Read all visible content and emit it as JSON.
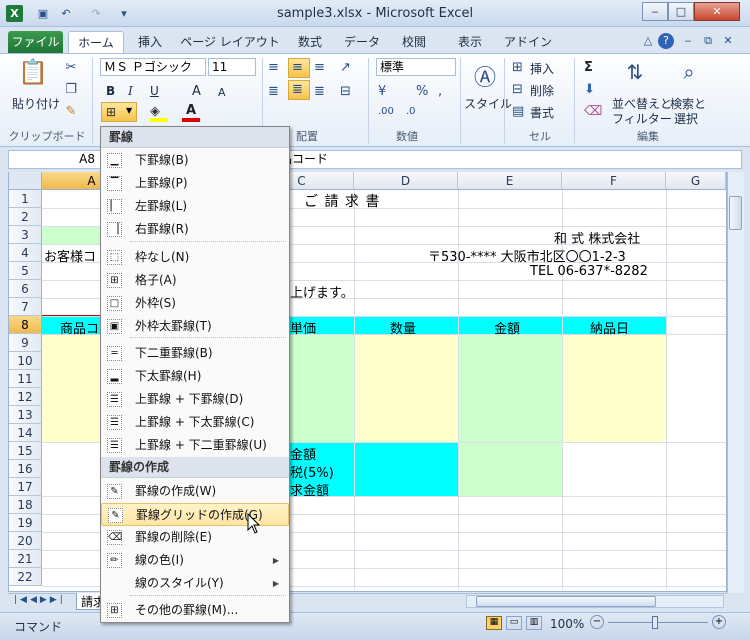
{
  "window": {
    "title": "sample3.xlsx - Microsoft Excel",
    "app_icon": "X"
  },
  "tabs": {
    "file": "ファイル",
    "items": [
      "ホーム",
      "挿入",
      "ページ レイアウト",
      "数式",
      "データ",
      "校閲",
      "表示",
      "アドイン"
    ]
  },
  "ribbon": {
    "paste": "貼り付け",
    "font_name": "ＭＳ Ｐゴシック",
    "font_size": "11",
    "bold": "B",
    "italic": "I",
    "underline": "U",
    "grow": "A",
    "shrink": "A",
    "number_format": "標準",
    "style": "スタイル",
    "insert": "挿入",
    "delete": "削除",
    "format": "書式",
    "sort_filter_1": "並べ替えと",
    "sort_filter_2": "フィルター",
    "find_select_1": "検索と",
    "find_select_2": "選択",
    "groups": {
      "clipboard": "クリップボード",
      "alignment": "配置",
      "number": "数値",
      "cells": "セル",
      "edit": "編集"
    }
  },
  "formula_bar": {
    "name_box": "A8",
    "value": "品コード"
  },
  "columns": [
    "A",
    "C",
    "D",
    "E",
    "F",
    "G"
  ],
  "rows": [
    "1",
    "2",
    "3",
    "4",
    "5",
    "6",
    "7",
    "8",
    "9",
    "10",
    "11",
    "12",
    "13",
    "14",
    "15",
    "16",
    "17",
    "18",
    "19",
    "20",
    "21",
    "22"
  ],
  "cells": {
    "title": "ご 請 求 書",
    "company": "和 式 株式会社",
    "address": "〒530-**** 大阪市北区〇〇1-2-3",
    "tel": "TEL 06-637*-8282",
    "customer": "お客様コ",
    "greeting": "上げます。",
    "h_code": "商品コ",
    "h_price": "単価",
    "h_qty": "数量",
    "h_amount": "金額",
    "h_date": "納品日",
    "subtotal": "金額",
    "tax": "税(5%)",
    "total": "求金額"
  },
  "sheet_tab": "請求",
  "status": {
    "mode": "コマンド",
    "zoom": "100%"
  },
  "menu": {
    "header1": "罫線",
    "header2": "罫線の作成",
    "items1": [
      "下罫線(B)",
      "上罫線(P)",
      "左罫線(L)",
      "右罫線(R)",
      "枠なし(N)",
      "格子(A)",
      "外枠(S)",
      "外枠太罫線(T)",
      "下二重罫線(B)",
      "下太罫線(H)",
      "上罫線 + 下罫線(D)",
      "上罫線 + 下太罫線(C)",
      "上罫線 + 下二重罫線(U)"
    ],
    "items2": [
      "罫線の作成(W)",
      "罫線グリッドの作成(G)",
      "罫線の削除(E)",
      "線の色(I)",
      "線のスタイル(Y)",
      "その他の罫線(M)..."
    ]
  },
  "colors": {
    "cyan": "#00ffff",
    "yellow": "#ffffcc",
    "green": "#ccffcc",
    "file_tab": "#2a8a40"
  }
}
